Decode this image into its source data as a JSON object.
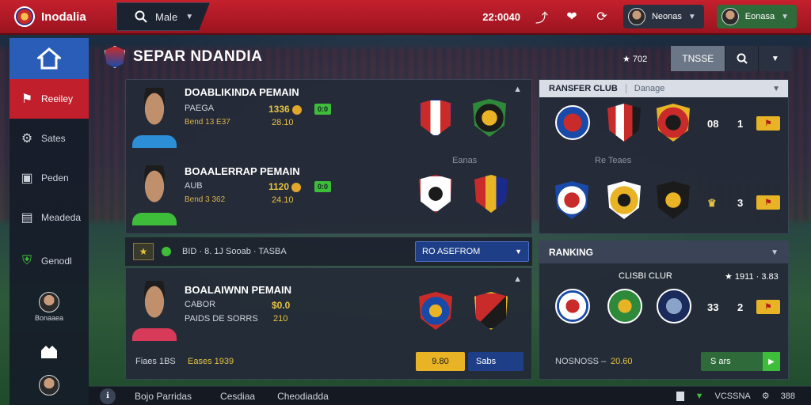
{
  "topbar": {
    "brand": "Inodalia",
    "search_label": "Male",
    "coins": "22:0040",
    "user1": "Neonas",
    "user2": "Eonasa"
  },
  "sidebar": {
    "items": [
      {
        "label": "Reeiley",
        "icon": "flag-icon"
      },
      {
        "label": "Sates",
        "icon": "gear-icon"
      },
      {
        "label": "Peden",
        "icon": "briefcase-icon"
      },
      {
        "label": "Meadeda",
        "icon": "document-icon"
      },
      {
        "label": "Genodl",
        "icon": "shield-icon"
      }
    ],
    "user_label": "Bonaaea"
  },
  "main": {
    "title": "SEPAR NDANDIA",
    "rating": "★ 702",
    "tab_label": "TNSSE"
  },
  "players_top": [
    {
      "name": "DOABLIKINDA PEMAIN",
      "meta": "PAEGA",
      "meta2": "Bend 13 E37",
      "value": "1336",
      "tag": "0:0",
      "sub": "28.10",
      "shirt": "#2d8ed8"
    },
    {
      "name": "BOAALERRAP PEMAIN",
      "meta": "AUB",
      "meta2": "Bend 3 362",
      "value": "1120",
      "tag": "0:0",
      "sub": "24.10",
      "shirt": "#3ebd3a"
    }
  ],
  "panel1_mid": "Eanas",
  "strip": {
    "text": "BID · 8. 1J Sooab · TASBA",
    "select": "RO ASEFROM"
  },
  "player_bottom": {
    "name": "BOALAIWNN PEMAIN",
    "meta": "CABOR",
    "meta2": "PAIDS DE SORRS",
    "value": "$0.0",
    "sub": "210",
    "shirt": "#d83a5a",
    "foot_left": "Fiaes 1BS",
    "foot_mid": "Eases 1939",
    "btn_yellow": "9.80",
    "btn_navy": "Sabs"
  },
  "transfer": {
    "title": "RANSFER CLUB",
    "sub": "Danage",
    "row1_score": "08",
    "row1_score2": "1",
    "mid_label": "Re Teaes",
    "row2_score2": "3"
  },
  "ranking": {
    "title": "RANKING",
    "club_label": "CLISBI CLUR",
    "club_rating": "★ 1911 · 3.83",
    "score": "33",
    "score2": "2",
    "footer_left": "NOSNOSS –",
    "footer_mid": "20.60",
    "stat_btn": "S ars"
  },
  "bottombar": {
    "item1": "Bojo Parridas",
    "item2": "Cesdiaa",
    "item3": "Cheodiadda",
    "right1": "VCSSNA",
    "right2": "388"
  },
  "colors": {
    "accent_red": "#c21f2c",
    "accent_blue": "#2a5db8",
    "gold": "#e8b426",
    "green": "#3ebd3a"
  }
}
